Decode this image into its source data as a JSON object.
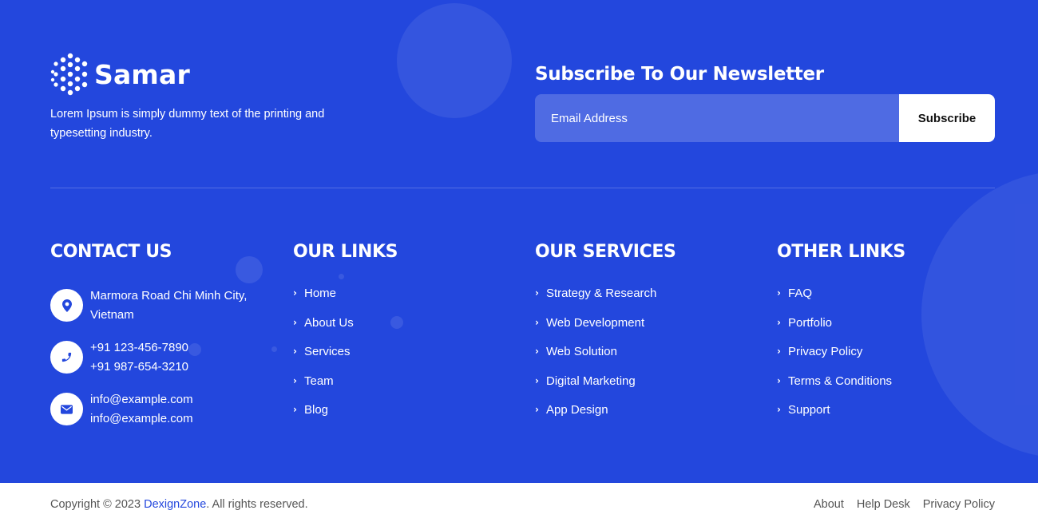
{
  "brand": {
    "name": "Samar",
    "description": "Lorem Ipsum is simply dummy text of the printing and typesetting industry."
  },
  "newsletter": {
    "title": "Subscribe To Our Newsletter",
    "email_placeholder": "Email Address",
    "button_label": "Subscribe"
  },
  "contact": {
    "heading": "CONTACT US",
    "address": [
      "Marmora Road Chi Minh City,",
      "Vietnam"
    ],
    "phones": [
      "+91 123-456-7890",
      "+91 987-654-3210"
    ],
    "emails": [
      "info@example.com",
      "info@example.com"
    ]
  },
  "our_links": {
    "heading": "OUR LINKS",
    "items": [
      "Home",
      "About Us",
      "Services",
      "Team",
      "Blog"
    ]
  },
  "our_services": {
    "heading": "OUR SERVICES",
    "items": [
      "Strategy & Research",
      "Web Development",
      "Web Solution",
      "Digital Marketing",
      "App Design"
    ]
  },
  "other_links": {
    "heading": "OTHER LINKS",
    "items": [
      "FAQ",
      "Portfolio",
      "Privacy Policy",
      "Terms & Conditions",
      "Support"
    ]
  },
  "bottom_bar": {
    "copyright_prefix": "Copyright © 2023 ",
    "company_link": "DexignZone",
    "copyright_suffix": ". All rights reserved.",
    "links": [
      "About",
      "Help Desk",
      "Privacy Policy"
    ]
  },
  "colors": {
    "primary": "#2347dd",
    "white": "#ffffff",
    "muted_text": "#555555"
  },
  "icons": {
    "logo": "hexagon-dots-logo-icon",
    "address": "map-pin-icon",
    "phone": "phone-icon",
    "email": "envelope-icon",
    "link_bullet": "chevron-right-icon"
  }
}
